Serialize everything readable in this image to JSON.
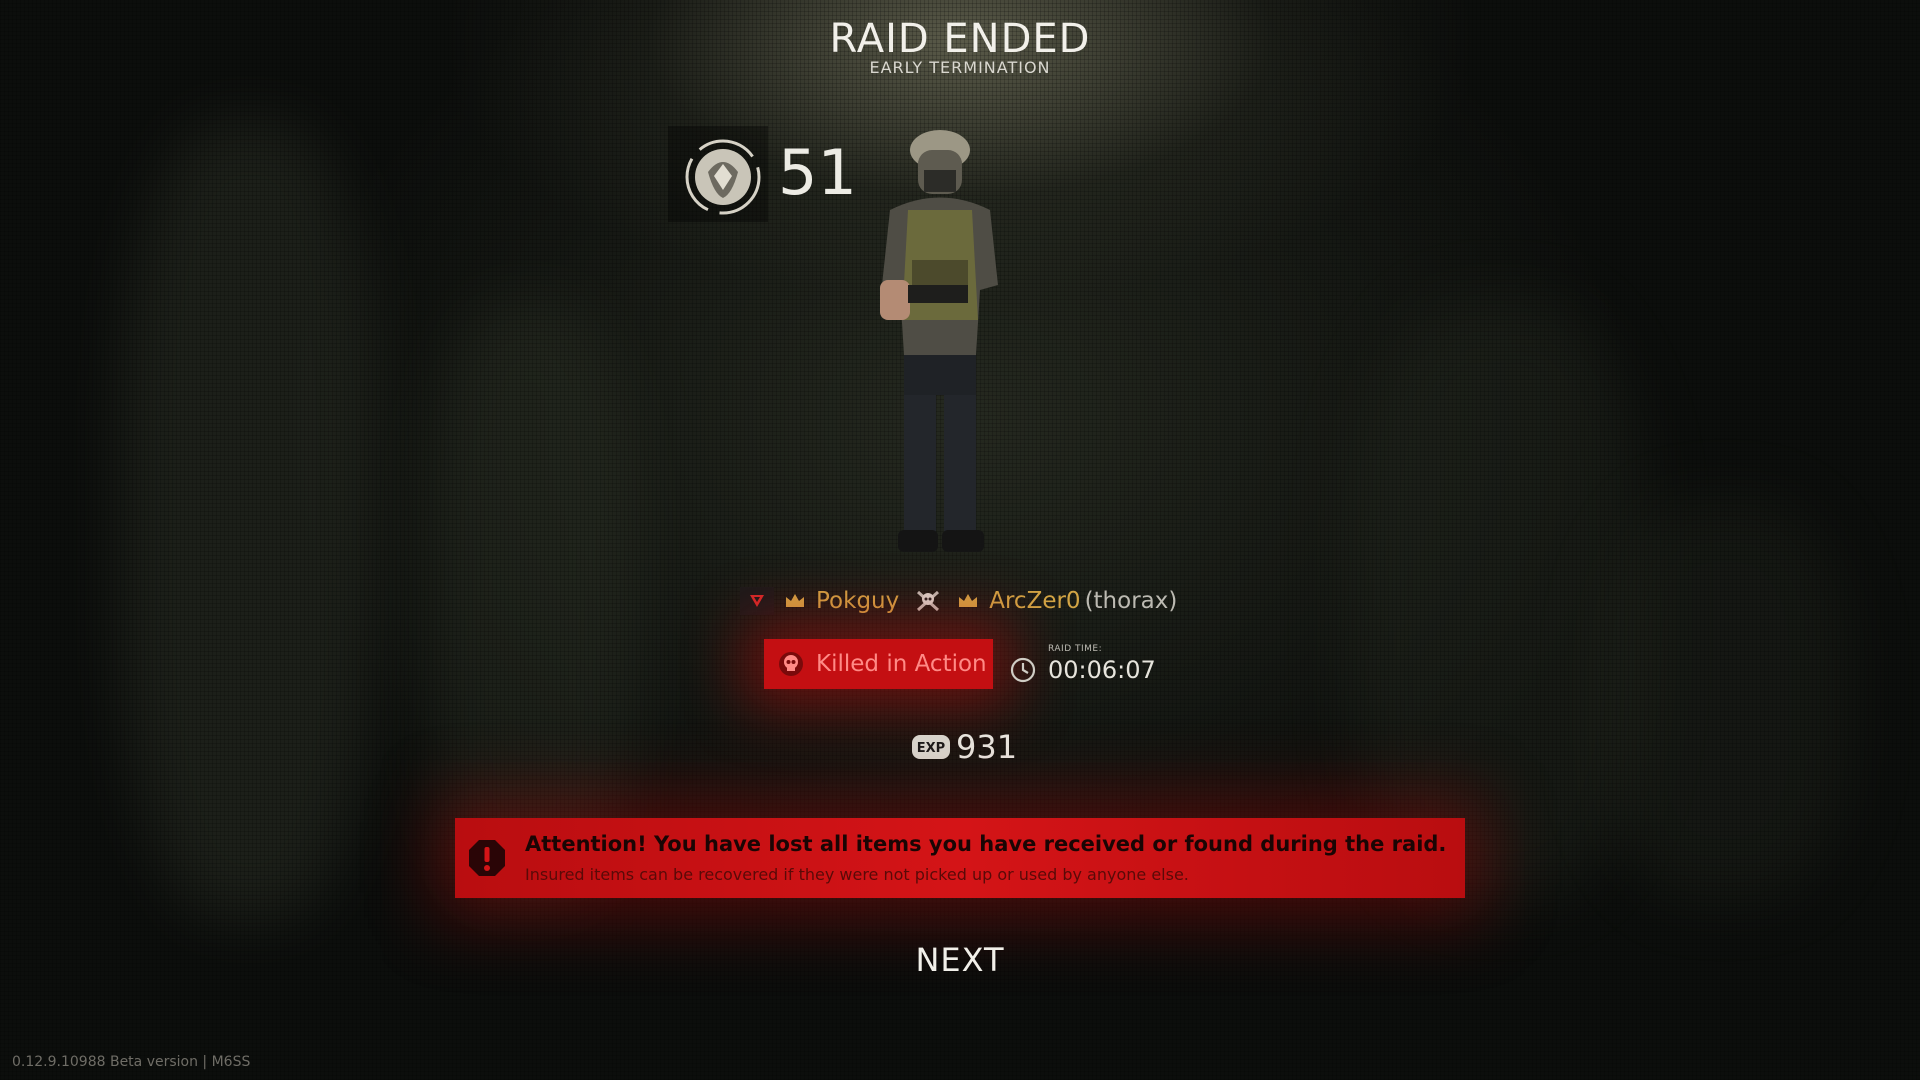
{
  "header": {
    "title": "RAID ENDED",
    "subtitle": "EARLY TERMINATION"
  },
  "player": {
    "level": "51",
    "level_icon": "rank-badge-icon"
  },
  "killer_row": {
    "victim_name": "Pokguy",
    "killer_name": "ArcZer0",
    "killer_weapon": "(thorax)",
    "faction_icon": "faction-badge-icon",
    "crown_icon": "crown-icon",
    "kill_icon": "skull-crossbones-icon",
    "gold_color": "#d2a545"
  },
  "status": {
    "label": "Killed in Action",
    "icon": "skull-icon",
    "color": "#c40f12"
  },
  "raid_time": {
    "label": "RAID TIME:",
    "value": "00:06:07"
  },
  "experience": {
    "badge": "EXP",
    "value": "931"
  },
  "warning": {
    "title": "Attention! You have lost all items you have received or found during the raid.",
    "subtitle": "Insured items can be recovered if they were not picked up or used by anyone else.",
    "icon": "alert-octagon-icon"
  },
  "actions": {
    "next_label": "NEXT"
  },
  "footer": {
    "version": "0.12.9.10988 Beta version | M6SS"
  }
}
